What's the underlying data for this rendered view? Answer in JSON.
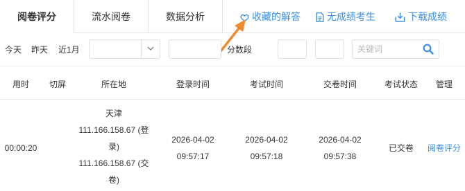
{
  "tabs": [
    {
      "label": "阅卷评分",
      "active": true
    },
    {
      "label": "流水阅卷",
      "active": false
    },
    {
      "label": "数据分析",
      "active": false
    }
  ],
  "actions": {
    "favorites": {
      "label": "收藏的解答",
      "icon": "heart-icon"
    },
    "no_score": {
      "label": "无成绩考生",
      "icon": "document-icon"
    },
    "download": {
      "label": "下载成绩",
      "icon": "download-icon"
    }
  },
  "filters": {
    "today": "今天",
    "yesterday": "昨天",
    "last_month": "近1月",
    "score_range_label": "分数段",
    "keyword_placeholder": "关键词"
  },
  "table": {
    "headers": [
      "用时",
      "切屏",
      "所在地",
      "登录时间",
      "考试时间",
      "交卷时间",
      "考试状态",
      "管理"
    ],
    "rows": [
      {
        "duration": "00:00:20",
        "switch_screen": "",
        "location_city": "天津",
        "login_ip_a": "111.166.158.67 (登",
        "login_ip_b": "录)",
        "submit_ip_a": "111.166.158.67 (交",
        "submit_ip_b": "卷)",
        "login_date": "2026-04-02",
        "login_clock": "09:57:17",
        "exam_date": "2026-04-02",
        "exam_clock": "09:57:18",
        "submit_date": "2026-04-02",
        "submit_clock": "09:57:38",
        "status": "已交卷",
        "manage": "阅卷评分"
      }
    ]
  },
  "colors": {
    "accent": "#3a8ee6",
    "annotation": "#f08a2c"
  }
}
